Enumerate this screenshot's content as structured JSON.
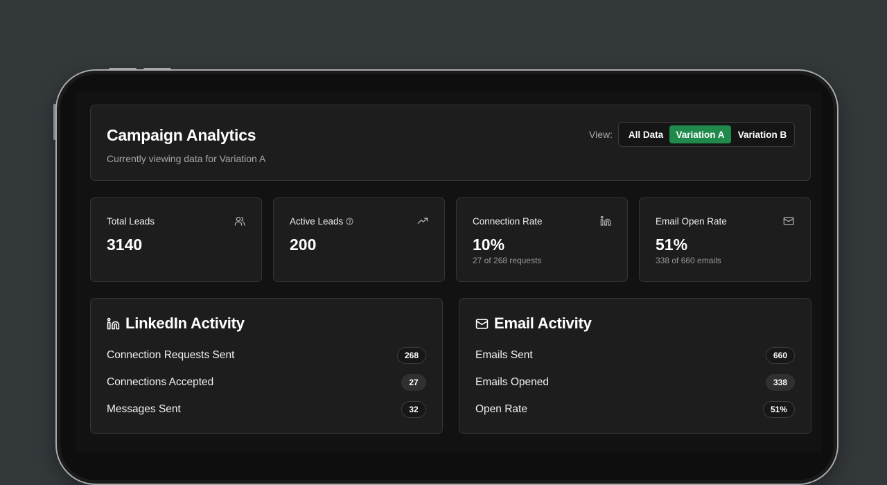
{
  "header": {
    "title": "Campaign Analytics",
    "subtitle": "Currently viewing data for Variation A",
    "view_label": "View:",
    "view_options": [
      "All Data",
      "Variation A",
      "Variation B"
    ],
    "selected_view": "Variation A"
  },
  "stats": [
    {
      "label": "Total Leads",
      "value": "3140",
      "sub": "",
      "icon": "users-icon"
    },
    {
      "label": "Active Leads",
      "value": "200",
      "sub": "",
      "icon": "trending-up-icon",
      "has_help": true
    },
    {
      "label": "Connection Rate",
      "value": "10%",
      "sub": "27 of 268 requests",
      "icon": "linkedin-icon"
    },
    {
      "label": "Email Open Rate",
      "value": "51%",
      "sub": "338 of 660 emails",
      "icon": "mail-icon"
    }
  ],
  "linkedin": {
    "title": "LinkedIn Activity",
    "icon": "linkedin-icon",
    "rows": [
      {
        "label": "Connection Requests Sent",
        "value": "268"
      },
      {
        "label": "Connections Accepted",
        "value": "27"
      },
      {
        "label": "Messages Sent",
        "value": "32"
      }
    ]
  },
  "email": {
    "title": "Email Activity",
    "icon": "mail-icon",
    "rows": [
      {
        "label": "Emails Sent",
        "value": "660"
      },
      {
        "label": "Emails Opened",
        "value": "338"
      },
      {
        "label": "Open Rate",
        "value": "51%"
      }
    ]
  },
  "colors": {
    "accent": "#1f8a4c",
    "background": "#33383b",
    "card": "#1d1d1d"
  }
}
